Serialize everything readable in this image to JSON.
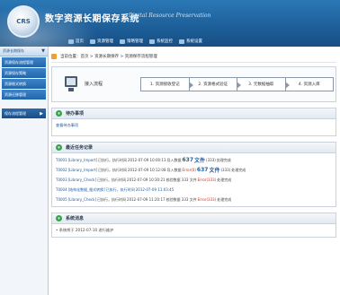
{
  "header": {
    "logo_text": "CRS",
    "title": "数字资源长期保存系统",
    "subtitle": "Digital Resource Preservation",
    "menu": [
      "首页",
      "资源管理",
      "策略管理",
      "系统监控",
      "系统设置"
    ]
  },
  "sidebar": {
    "header_label": "资源长期保存",
    "items": [
      "资源保存流程管理",
      "资源保存策略",
      "资源格式转换",
      "资源迁移管理"
    ],
    "selected_label": "保存流程管理",
    "arrow_header": "▼",
    "arrow_selected": "▶"
  },
  "breadcrumb": {
    "text": "当前位置：首页 > 资源长期保存 > 资源保存流程管理"
  },
  "workflow": {
    "title": "接入流程",
    "steps": [
      "1. 资源接收登记",
      "2. 资源格式验证",
      "3. 元数据抽取",
      "4. 资源入库"
    ]
  },
  "notice": {
    "title": "待办事项",
    "link": "查看待办事项"
  },
  "tasks": {
    "title": "最近任务记录",
    "rows": [
      {
        "id": "T0001",
        "link": "[Library_Import]",
        "action": "已执行，执行时间",
        "time": "2012-07-09 10:00:13",
        "detail": "导入数据",
        "size_big": "637",
        "unit": "文件",
        "extra": "(333)",
        "state": "处理完成",
        "hl": ""
      },
      {
        "id": "T0002",
        "link": "[Library_Import]",
        "action": "已执行，执行时间",
        "time": "2012-07-09 10:12:08",
        "detail": "导入数据",
        "size_big": "637",
        "unit": "文件",
        "extra": "(333)",
        "state": "处理完成",
        "hl": "Error(0)"
      },
      {
        "id": "T0003",
        "link": "[Library_Check]",
        "action": "已执行，执行时间",
        "time": "2012-07-09 10:30:21",
        "detail": "校验数据 333 文件",
        "size_big": "",
        "unit": "",
        "extra": "",
        "state": "处理完成",
        "hl": "Error(333)"
      },
      {
        "id": "T0004",
        "link": "[结构化数据_格式转换]",
        "action": "已执行，执行时间",
        "time": "2012-07-09 11:03:45",
        "detail": "",
        "size_big": "",
        "unit": "",
        "extra": "",
        "state": "",
        "hl": ""
      },
      {
        "id": "T0005",
        "link": "[Library_Check]",
        "action": "已执行，执行时间",
        "time": "2012-07-09 11:20:17",
        "detail": "校验数据 333 文件",
        "size_big": "",
        "unit": "",
        "extra": "",
        "state": "处理完成",
        "hl": "Error(333)"
      }
    ]
  },
  "recent": {
    "title": "系统消息",
    "row": "• 系统将于 2012-07-10 进行维护"
  },
  "colors": {
    "banner": "#1d5e98",
    "sidebar_item": "#2166ab",
    "link": "#1e5ea1",
    "error": "#d0301f"
  }
}
